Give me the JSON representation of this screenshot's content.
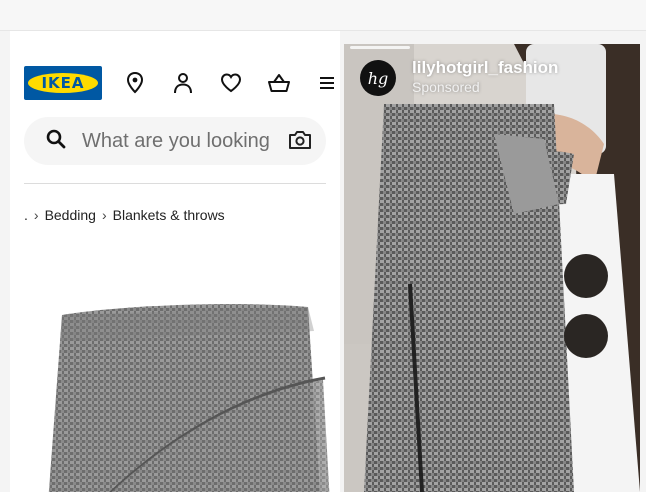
{
  "colors": {
    "ikea_blue": "#0058a3",
    "ikea_yellow": "#ffdb00",
    "page_bg": "#ffffff"
  },
  "ikea": {
    "logo_text": "IKEA",
    "nav_icons": [
      "location-pin-icon",
      "account-icon",
      "favourites-heart-icon",
      "shopping-bag-icon",
      "menu-icon"
    ],
    "search": {
      "placeholder": "What are you looking",
      "left_icon": "search-icon",
      "right_icon": "camera-icon"
    },
    "breadcrumb": {
      "ellipsis": ".",
      "items": [
        "Bedding",
        "Blankets & throws"
      ]
    },
    "product_image": "folded grey knit blanket"
  },
  "instagram_ad": {
    "avatar_initials": "hg",
    "username": "lilyhotgirl_fashion",
    "label": "Sponsored",
    "image": "woman wearing grey knit cardigan with sunglasses"
  }
}
